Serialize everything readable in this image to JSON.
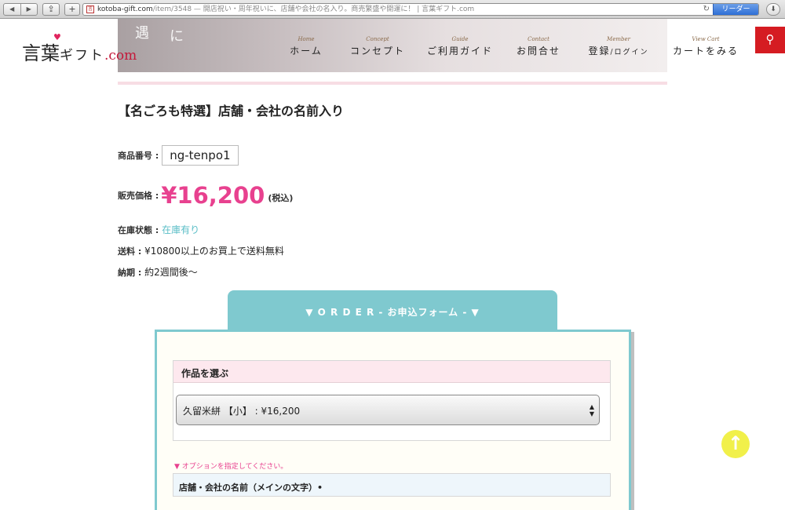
{
  "browser": {
    "url_domain": "kotoba-gift.com",
    "url_path": "/item/3548",
    "page_title": " — 開店祝い・周年祝いに、店舗や会社の名入り。商売繁盛や開運に！ | 言葉ギフト.com",
    "reader_label": "リーダー",
    "back_icon": "◀",
    "forward_icon": "▶",
    "share_icon": "⇪",
    "add_icon": "+",
    "reload_icon": "↻",
    "download_icon": "⬇"
  },
  "header": {
    "logo": {
      "part1": "言",
      "part2": "葉",
      "part3": "ギフト",
      "part4": ".com",
      "heart": "♥"
    },
    "banner_text": [
      "遇",
      "に"
    ],
    "nav": [
      {
        "en": "Home",
        "jp": "ホーム"
      },
      {
        "en": "Concept",
        "jp": "コンセプト"
      },
      {
        "en": "Guide",
        "jp": "ご利用ガイド"
      },
      {
        "en": "Contact",
        "jp": "お問合せ"
      },
      {
        "en": "Member",
        "jp": "登録",
        "jp_small": "/ログイン"
      },
      {
        "en": "View Cart",
        "jp": "カートをみる"
      }
    ],
    "search_icon": "⚲"
  },
  "product": {
    "title": "【名ごろも特選】店舗・会社の名前入り",
    "code_label": "商品番号 :",
    "code": "ng-tenpo1",
    "price_label": "販売価格 :",
    "price": "¥16,200",
    "tax": "(税込)",
    "stock_label": "在庫状態 :",
    "stock": "在庫有り",
    "shipping_label": "送料 :",
    "shipping": "¥10800以上のお買上で送料無料",
    "delivery_label": "納期 :",
    "delivery": "約2週間後〜"
  },
  "order": {
    "tab_label": "▼ O R D E R - お申込フォーム - ▼",
    "select_heading": "作品を選ぶ",
    "selected_option": "久留米絣 【小】 : ¥16,200",
    "option_note": "▼ オプションを指定してください。",
    "name_heading": "店舗・会社の名前（メインの文字）•"
  },
  "scroll_top_icon": "↑"
}
